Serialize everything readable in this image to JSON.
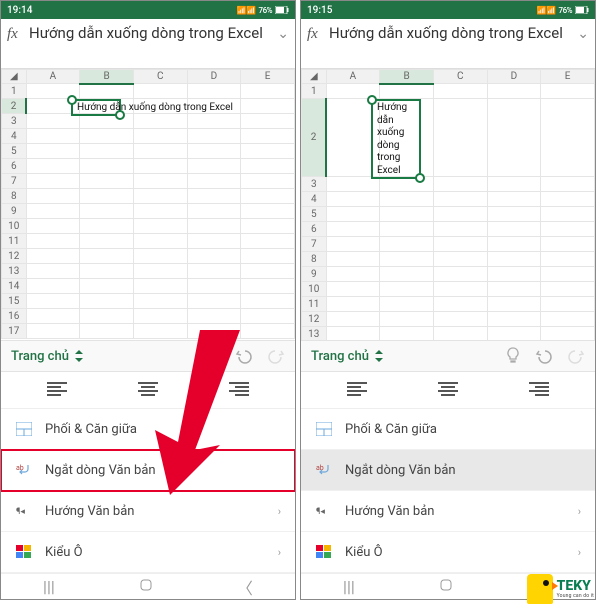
{
  "left": {
    "status_time": "19:14",
    "status_battery": "76%",
    "fx_text": "Hướng dẫn xuống dòng trong Excel",
    "columns": [
      "A",
      "B",
      "C",
      "D",
      "E"
    ],
    "selected_col": "B",
    "selected_row": "2",
    "cell_text": "Hướng dẫn xuống dòng trong Excel",
    "tab_label": "Trang chủ",
    "menu": {
      "merge": "Phối & Căn giữa",
      "wrap": "Ngắt dòng Văn bản",
      "direction": "Hướng Văn bản",
      "style": "Kiểu Ô"
    }
  },
  "right": {
    "status_time": "19:15",
    "status_battery": "76%",
    "fx_text": "Hướng dẫn xuống dòng trong Excel",
    "columns": [
      "A",
      "B",
      "C",
      "D",
      "E"
    ],
    "selected_col": "B",
    "selected_row": "2",
    "cell_lines": [
      "Hướng",
      "dẫn",
      "xuống",
      "dòng",
      "trong",
      "Excel"
    ],
    "tab_label": "Trang chủ",
    "menu": {
      "merge": "Phối & Căn giữa",
      "wrap": "Ngắt dòng Văn bản",
      "direction": "Hướng Văn bản",
      "style": "Kiểu Ô"
    }
  },
  "logo": {
    "brand": "TEKY",
    "tag": "Young can do it"
  }
}
